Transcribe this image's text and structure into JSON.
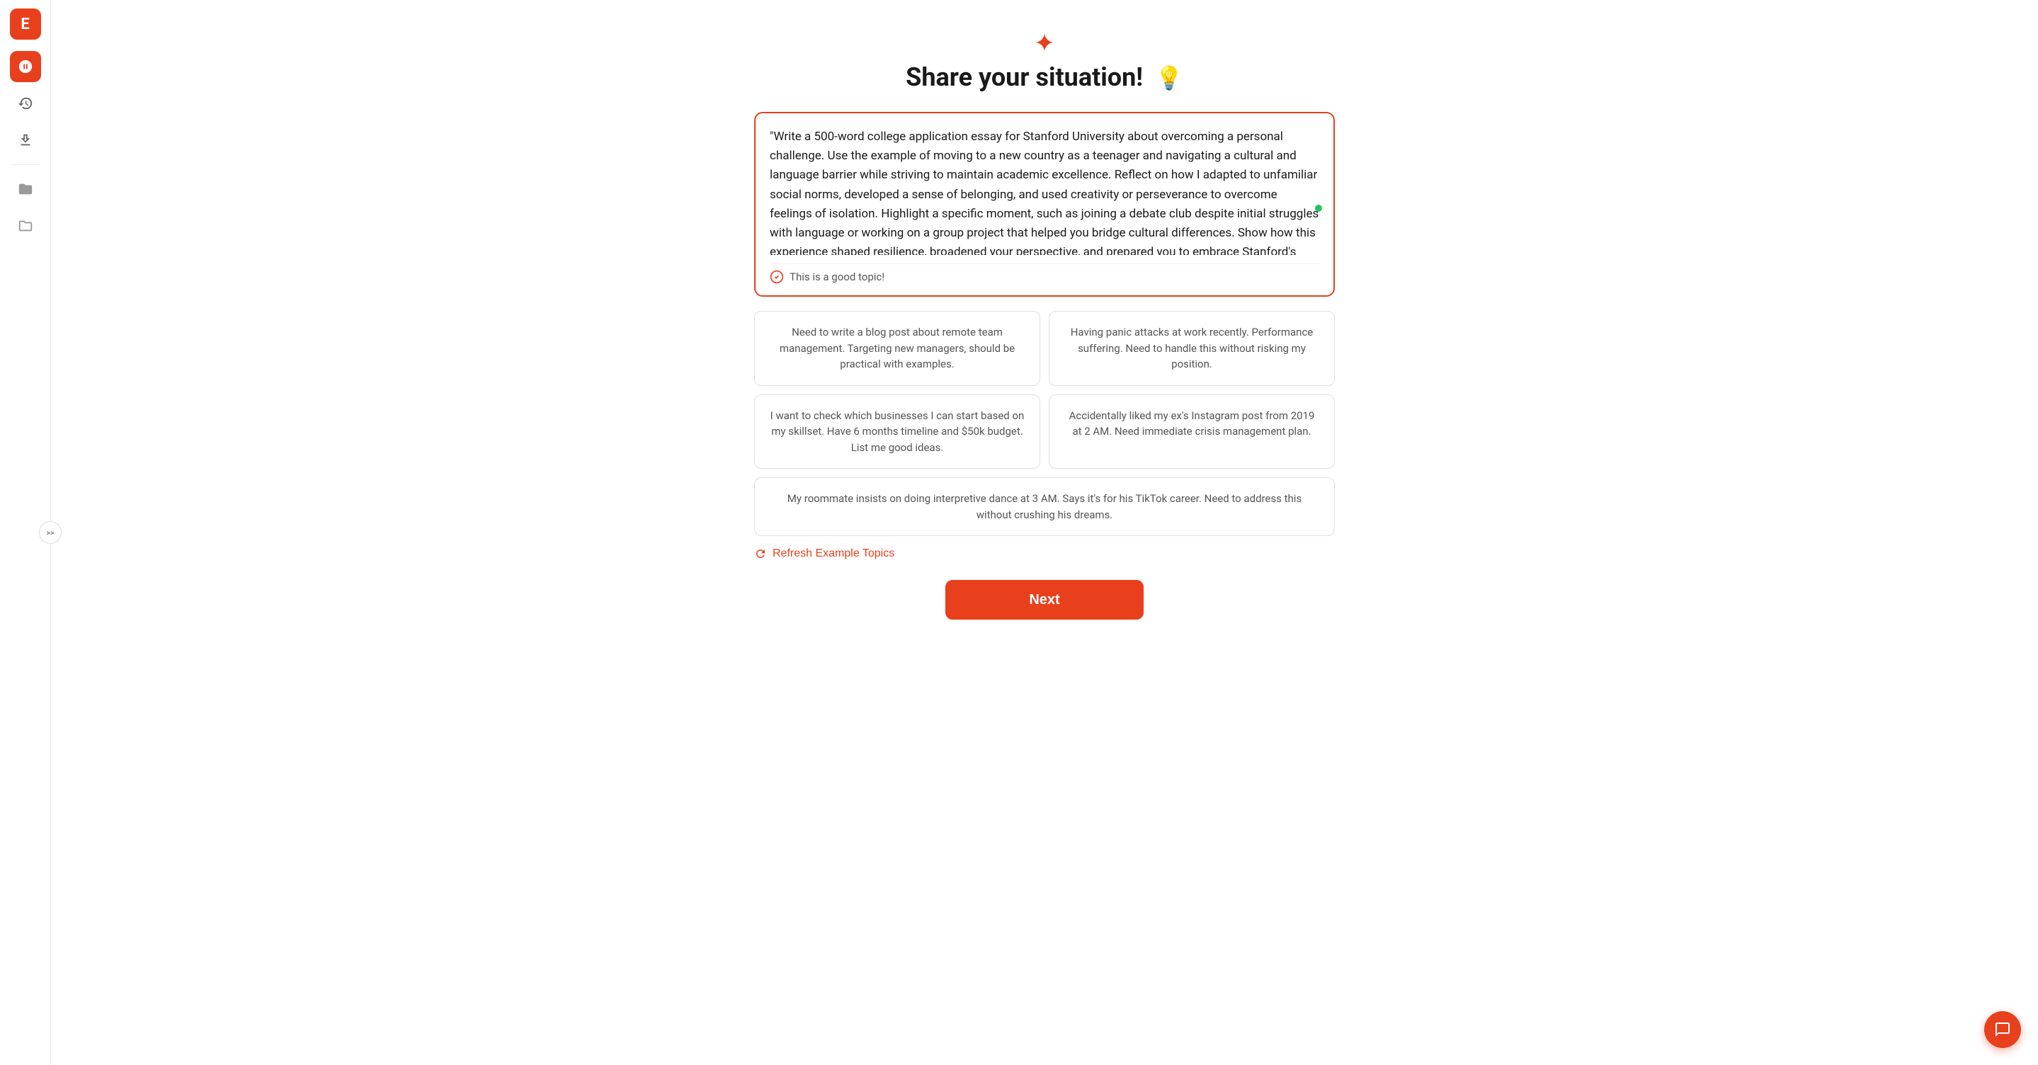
{
  "sidebar": {
    "logo_label": "E",
    "items": [
      {
        "name": "ai-button",
        "label": "AI",
        "active": true
      },
      {
        "name": "history-button",
        "label": "History",
        "active": false
      },
      {
        "name": "export-button",
        "label": "Export",
        "active": false
      }
    ],
    "folder_items": [
      {
        "name": "folder-1",
        "label": "Folder 1"
      },
      {
        "name": "folder-2",
        "label": "Folder 2"
      }
    ],
    "expand_label": ">>"
  },
  "page": {
    "icon": "✦",
    "title": "Share your situation!",
    "title_emoji": "💡",
    "textarea_value": "\"Write a 500-word college application essay for Stanford University about overcoming a personal challenge. Use the example of moving to a new country as a teenager and navigating a cultural and language barrier while striving to maintain academic excellence. Reflect on how I adapted to unfamiliar social norms, developed a sense of belonging, and used creativity or perseverance to overcome feelings of isolation. Highlight a specific moment, such as joining a debate club despite initial struggles with language or working on a group project that helped you bridge cultural differences. Show how this experience shaped resilience, broadened your perspective, and prepared you to embrace Stanford's diverse community and opportunities.\" write in German language",
    "good_topic_label": "This is a good topic!",
    "example_topics": [
      {
        "id": "topic-1",
        "text": "Need to write a blog post about remote team management. Targeting new managers, should be practical with examples.",
        "wide": false
      },
      {
        "id": "topic-2",
        "text": "Having panic attacks at work recently. Performance suffering. Need to handle this without risking my position.",
        "wide": false
      },
      {
        "id": "topic-3",
        "text": "I want to check which businesses I can start based on my skillset. Have 6 months timeline and $50k budget. List me good ideas.",
        "wide": false
      },
      {
        "id": "topic-4",
        "text": "Accidentally liked my ex's Instagram post from 2019 at 2 AM. Need immediate crisis management plan.",
        "wide": false
      },
      {
        "id": "topic-5",
        "text": "My roommate insists on doing interpretive dance at 3 AM. Says it's for his TikTok career. Need to address this without crushing his dreams.",
        "wide": true
      }
    ],
    "refresh_label": "Refresh Example Topics",
    "next_label": "Next"
  }
}
